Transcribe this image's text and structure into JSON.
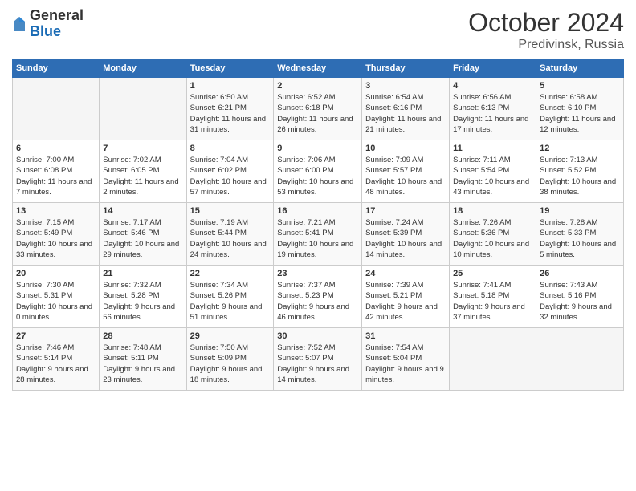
{
  "header": {
    "logo": {
      "general": "General",
      "blue": "Blue"
    },
    "title": "October 2024",
    "location": "Predivinsk, Russia"
  },
  "days_of_week": [
    "Sunday",
    "Monday",
    "Tuesday",
    "Wednesday",
    "Thursday",
    "Friday",
    "Saturday"
  ],
  "weeks": [
    [
      {
        "day": "",
        "info": ""
      },
      {
        "day": "",
        "info": ""
      },
      {
        "day": "1",
        "info": "Sunrise: 6:50 AM\nSunset: 6:21 PM\nDaylight: 11 hours and 31 minutes."
      },
      {
        "day": "2",
        "info": "Sunrise: 6:52 AM\nSunset: 6:18 PM\nDaylight: 11 hours and 26 minutes."
      },
      {
        "day": "3",
        "info": "Sunrise: 6:54 AM\nSunset: 6:16 PM\nDaylight: 11 hours and 21 minutes."
      },
      {
        "day": "4",
        "info": "Sunrise: 6:56 AM\nSunset: 6:13 PM\nDaylight: 11 hours and 17 minutes."
      },
      {
        "day": "5",
        "info": "Sunrise: 6:58 AM\nSunset: 6:10 PM\nDaylight: 11 hours and 12 minutes."
      }
    ],
    [
      {
        "day": "6",
        "info": "Sunrise: 7:00 AM\nSunset: 6:08 PM\nDaylight: 11 hours and 7 minutes."
      },
      {
        "day": "7",
        "info": "Sunrise: 7:02 AM\nSunset: 6:05 PM\nDaylight: 11 hours and 2 minutes."
      },
      {
        "day": "8",
        "info": "Sunrise: 7:04 AM\nSunset: 6:02 PM\nDaylight: 10 hours and 57 minutes."
      },
      {
        "day": "9",
        "info": "Sunrise: 7:06 AM\nSunset: 6:00 PM\nDaylight: 10 hours and 53 minutes."
      },
      {
        "day": "10",
        "info": "Sunrise: 7:09 AM\nSunset: 5:57 PM\nDaylight: 10 hours and 48 minutes."
      },
      {
        "day": "11",
        "info": "Sunrise: 7:11 AM\nSunset: 5:54 PM\nDaylight: 10 hours and 43 minutes."
      },
      {
        "day": "12",
        "info": "Sunrise: 7:13 AM\nSunset: 5:52 PM\nDaylight: 10 hours and 38 minutes."
      }
    ],
    [
      {
        "day": "13",
        "info": "Sunrise: 7:15 AM\nSunset: 5:49 PM\nDaylight: 10 hours and 33 minutes."
      },
      {
        "day": "14",
        "info": "Sunrise: 7:17 AM\nSunset: 5:46 PM\nDaylight: 10 hours and 29 minutes."
      },
      {
        "day": "15",
        "info": "Sunrise: 7:19 AM\nSunset: 5:44 PM\nDaylight: 10 hours and 24 minutes."
      },
      {
        "day": "16",
        "info": "Sunrise: 7:21 AM\nSunset: 5:41 PM\nDaylight: 10 hours and 19 minutes."
      },
      {
        "day": "17",
        "info": "Sunrise: 7:24 AM\nSunset: 5:39 PM\nDaylight: 10 hours and 14 minutes."
      },
      {
        "day": "18",
        "info": "Sunrise: 7:26 AM\nSunset: 5:36 PM\nDaylight: 10 hours and 10 minutes."
      },
      {
        "day": "19",
        "info": "Sunrise: 7:28 AM\nSunset: 5:33 PM\nDaylight: 10 hours and 5 minutes."
      }
    ],
    [
      {
        "day": "20",
        "info": "Sunrise: 7:30 AM\nSunset: 5:31 PM\nDaylight: 10 hours and 0 minutes."
      },
      {
        "day": "21",
        "info": "Sunrise: 7:32 AM\nSunset: 5:28 PM\nDaylight: 9 hours and 56 minutes."
      },
      {
        "day": "22",
        "info": "Sunrise: 7:34 AM\nSunset: 5:26 PM\nDaylight: 9 hours and 51 minutes."
      },
      {
        "day": "23",
        "info": "Sunrise: 7:37 AM\nSunset: 5:23 PM\nDaylight: 9 hours and 46 minutes."
      },
      {
        "day": "24",
        "info": "Sunrise: 7:39 AM\nSunset: 5:21 PM\nDaylight: 9 hours and 42 minutes."
      },
      {
        "day": "25",
        "info": "Sunrise: 7:41 AM\nSunset: 5:18 PM\nDaylight: 9 hours and 37 minutes."
      },
      {
        "day": "26",
        "info": "Sunrise: 7:43 AM\nSunset: 5:16 PM\nDaylight: 9 hours and 32 minutes."
      }
    ],
    [
      {
        "day": "27",
        "info": "Sunrise: 7:46 AM\nSunset: 5:14 PM\nDaylight: 9 hours and 28 minutes."
      },
      {
        "day": "28",
        "info": "Sunrise: 7:48 AM\nSunset: 5:11 PM\nDaylight: 9 hours and 23 minutes."
      },
      {
        "day": "29",
        "info": "Sunrise: 7:50 AM\nSunset: 5:09 PM\nDaylight: 9 hours and 18 minutes."
      },
      {
        "day": "30",
        "info": "Sunrise: 7:52 AM\nSunset: 5:07 PM\nDaylight: 9 hours and 14 minutes."
      },
      {
        "day": "31",
        "info": "Sunrise: 7:54 AM\nSunset: 5:04 PM\nDaylight: 9 hours and 9 minutes."
      },
      {
        "day": "",
        "info": ""
      },
      {
        "day": "",
        "info": ""
      }
    ]
  ]
}
